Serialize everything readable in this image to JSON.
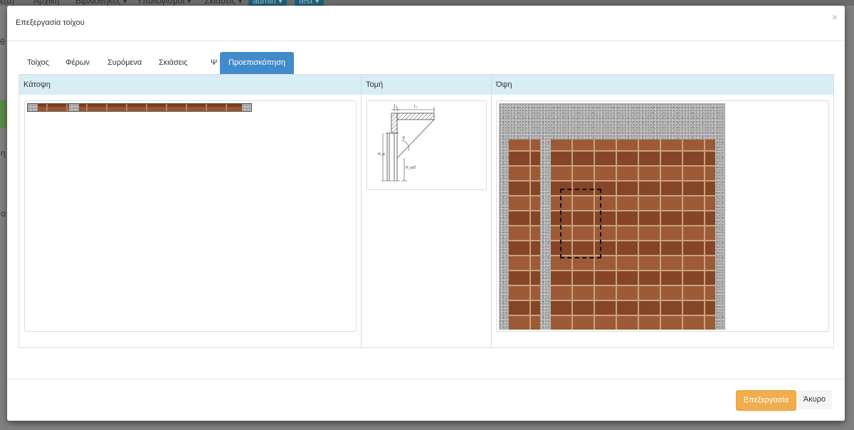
{
  "background": {
    "nav_items": [
      "ε(α)",
      "Αρχική",
      "Βιβλιοθήκες ▾",
      "Υπολογισμοί ▾",
      "Σκιάσεις ▾",
      "admin ▾",
      "test ▾"
    ],
    "left_texts": [
      "θ",
      "η",
      "ο"
    ]
  },
  "modal": {
    "title": "Επεξεργασία τοίχου",
    "close": "×",
    "tabs": [
      "Τοίχος",
      "Φέρων",
      "Συρόμενα",
      "Σκιάσεις",
      "Ψ",
      "Προεπισκόπηση"
    ],
    "active_tab": "Προεπισκόπηση",
    "columns": [
      "Κάτοψη",
      "Τομή",
      "Όψη"
    ],
    "section_labels": {
      "l1": "L₁",
      "l2": "L₂",
      "beta": "β",
      "hw": "H_w",
      "hw2": "H_w/2"
    },
    "footer": {
      "edit_button": "Επεξεργασία",
      "cancel_button": "Άκυρο"
    },
    "colors": {
      "accent": "#428bca",
      "header_bg": "#d9edf7",
      "edit_btn": "#f0ad4e",
      "brick": "#8f4e2d",
      "plaster": "#b3b3b3"
    }
  }
}
